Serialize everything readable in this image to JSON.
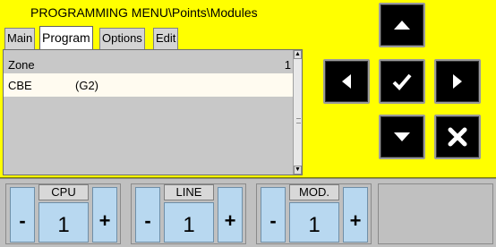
{
  "header": {
    "title": "PROGRAMMING MENU\\Points\\Modules"
  },
  "tabs": [
    {
      "label": "Main",
      "active": false
    },
    {
      "label": "Program",
      "active": true
    },
    {
      "label": "Options",
      "active": false
    },
    {
      "label": "Edit",
      "active": false
    }
  ],
  "list": {
    "header": {
      "label": "Zone",
      "value": "1"
    },
    "rows": [
      {
        "name": "CBE",
        "code": "(G2)"
      }
    ]
  },
  "nav": {
    "up_icon": "arrow-up-icon",
    "left_icon": "arrow-left-icon",
    "ok_icon": "checkmark-icon",
    "right_icon": "arrow-right-icon",
    "down_icon": "arrow-down-icon",
    "cancel_icon": "cross-icon"
  },
  "counters": [
    {
      "label": "CPU",
      "value": "1",
      "minus": "-",
      "plus": "+"
    },
    {
      "label": "LINE",
      "value": "1",
      "minus": "-",
      "plus": "+"
    },
    {
      "label": "MOD.",
      "value": "1",
      "minus": "-",
      "plus": "+"
    }
  ],
  "colors": {
    "panel": "#ffff00",
    "button": "#000000",
    "counter_field": "#b8d8f0",
    "background": "#c0c0c0"
  }
}
